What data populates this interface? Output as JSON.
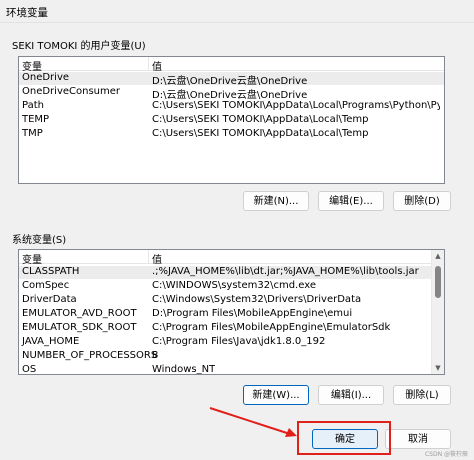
{
  "window": {
    "title": "环境变量"
  },
  "user_section": {
    "label": "SEKI TOMOKI 的用户变量(U)",
    "columns": [
      "变量",
      "值"
    ],
    "rows": [
      {
        "name": "OneDrive",
        "value": "D:\\云盘\\OneDrive云盘\\OneDrive",
        "selected": true
      },
      {
        "name": "OneDriveConsumer",
        "value": "D:\\云盘\\OneDrive云盘\\OneDrive"
      },
      {
        "name": "Path",
        "value": "C:\\Users\\SEKI TOMOKI\\AppData\\Local\\Programs\\Python\\Pytho..."
      },
      {
        "name": "TEMP",
        "value": "C:\\Users\\SEKI TOMOKI\\AppData\\Local\\Temp"
      },
      {
        "name": "TMP",
        "value": "C:\\Users\\SEKI TOMOKI\\AppData\\Local\\Temp"
      }
    ],
    "buttons": {
      "new": "新建(N)...",
      "edit": "编辑(E)...",
      "delete": "删除(D)"
    }
  },
  "system_section": {
    "label": "系统变量(S)",
    "columns": [
      "变量",
      "值"
    ],
    "rows": [
      {
        "name": "CLASSPATH",
        "value": ".;%JAVA_HOME%\\lib\\dt.jar;%JAVA_HOME%\\lib\\tools.jar",
        "selected": true
      },
      {
        "name": "ComSpec",
        "value": "C:\\WINDOWS\\system32\\cmd.exe"
      },
      {
        "name": "DriverData",
        "value": "C:\\Windows\\System32\\Drivers\\DriverData"
      },
      {
        "name": "EMULATOR_AVD_ROOT",
        "value": "D:\\Program Files\\MobileAppEngine\\emui"
      },
      {
        "name": "EMULATOR_SDK_ROOT",
        "value": "C:\\Program Files\\MobileAppEngine\\EmulatorSdk"
      },
      {
        "name": "JAVA_HOME",
        "value": "C:\\Program Files\\Java\\jdk1.8.0_192"
      },
      {
        "name": "NUMBER_OF_PROCESSORS",
        "value": "8"
      },
      {
        "name": "OS",
        "value": "Windows_NT"
      }
    ],
    "buttons": {
      "new": "新建(W)...",
      "edit": "编辑(I)...",
      "delete": "删除(L)"
    }
  },
  "dialog_buttons": {
    "ok": "确定",
    "cancel": "取消"
  },
  "annotation": {
    "color": "#e0201b"
  },
  "watermark": "CSDN @筱柠辰"
}
